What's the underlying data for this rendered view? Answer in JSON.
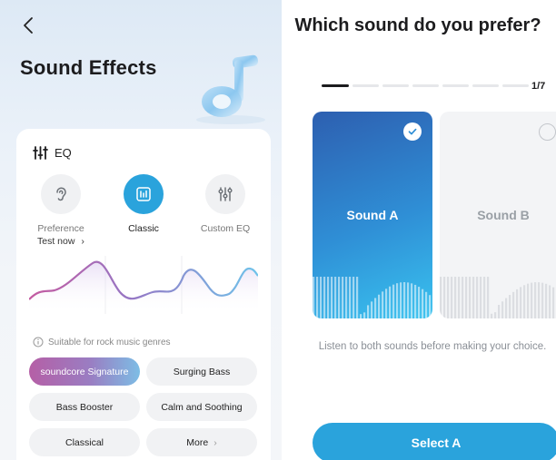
{
  "left": {
    "title": "Sound Effects",
    "eq_label": "EQ",
    "modes": [
      {
        "label": "Preference",
        "icon": "ear-icon"
      },
      {
        "label": "Classic",
        "icon": "equalizer-icon",
        "selected": true
      },
      {
        "label": "Custom EQ",
        "icon": "sliders-icon"
      }
    ],
    "test_now": "Test now",
    "test_now_arrow": "›",
    "info_text": "Suitable for rock music genres",
    "presets": [
      {
        "label": "soundcore Signature",
        "selected": true
      },
      {
        "label": "Surging Bass"
      },
      {
        "label": "Bass Booster"
      },
      {
        "label": "Calm and Soothing"
      },
      {
        "label": "Classical"
      },
      {
        "label": "More",
        "arrow": "›"
      }
    ],
    "accent_color": "#2aa3dc"
  },
  "right": {
    "question": "Which sound do you prefer?",
    "progress": {
      "current": 1,
      "total": 7,
      "text": "1/7"
    },
    "sound_a": {
      "label": "Sound A",
      "selected": true
    },
    "sound_b": {
      "label": "Sound B",
      "selected": false
    },
    "hint": "Listen to both sounds before making your choice.",
    "select_button": "Select A",
    "button_color": "#2aa3dc"
  }
}
